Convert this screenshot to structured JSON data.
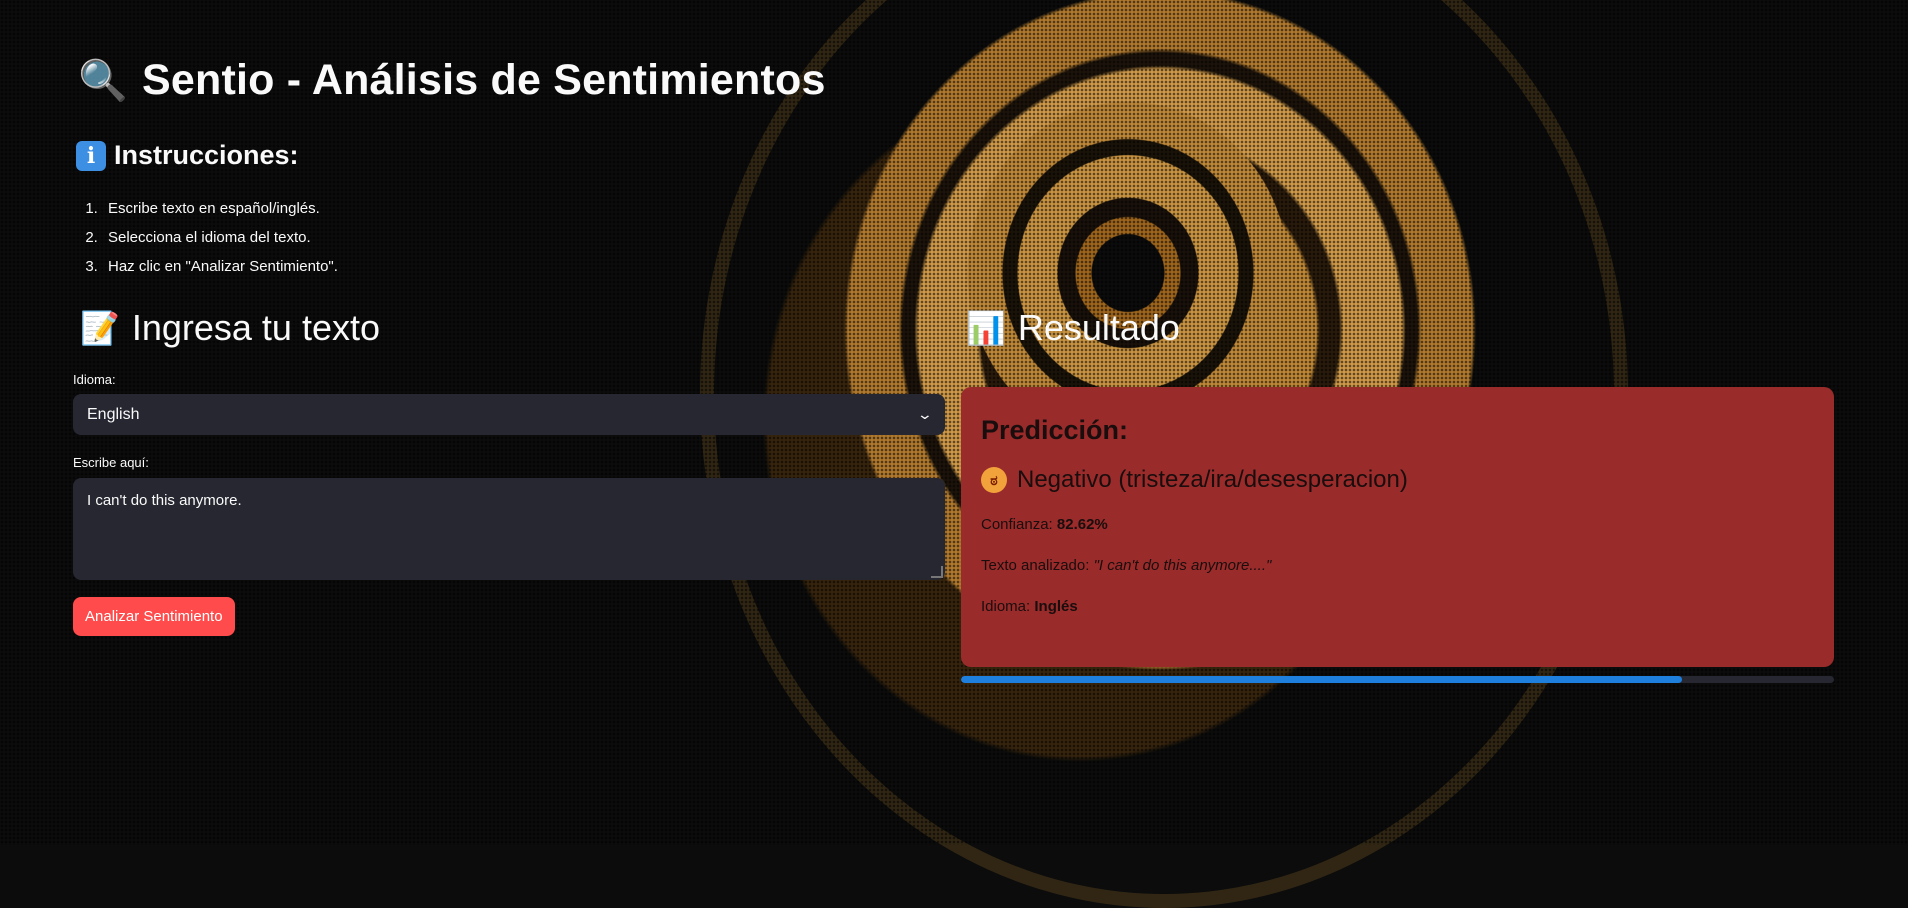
{
  "app": {
    "title": "Sentio - Análisis de Sentimientos",
    "title_icon": "magnifier-icon"
  },
  "instructions": {
    "heading": "Instrucciones:",
    "icon": "info-icon",
    "steps": [
      "Escribe texto en español/inglés.",
      "Selecciona el idioma del texto.",
      "Haz clic en \"Analizar Sentimiento\"."
    ]
  },
  "input_section": {
    "heading": "Ingresa tu texto",
    "icon": "memo-icon",
    "language_label": "Idioma:",
    "language_value": "English",
    "text_label": "Escribe aquí:",
    "text_value": "I can't do this anymore.",
    "button_label": "Analizar Sentimiento"
  },
  "result_section": {
    "heading": "Resultado",
    "icon": "bar-chart-icon",
    "prediction_heading": "Predicción:",
    "prediction_icon": "angry-face-icon",
    "prediction_text": "Negativo (tristeza/ira/desesperacion)",
    "confidence_label": "Confianza:",
    "confidence_value": "82.62%",
    "analyzed_label": "Texto analizado:",
    "analyzed_value": "\"I can't do this anymore....\"",
    "language_label": "Idioma:",
    "language_value": "Inglés",
    "progress_fraction": 0.8262
  },
  "colors": {
    "button": "#ff4b4b",
    "result_card": "#9a2b2b",
    "progress": "#1f7fdc",
    "input_bg": "#262730"
  }
}
